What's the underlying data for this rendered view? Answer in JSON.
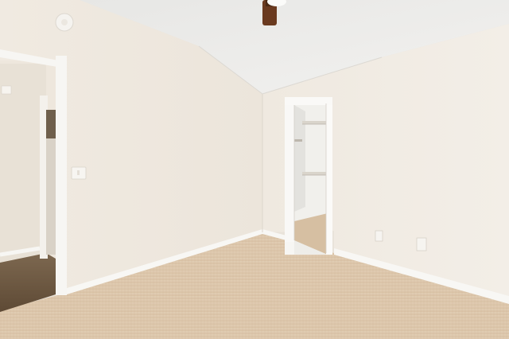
{
  "scene": {
    "kind": "photo",
    "subject": "empty-bedroom",
    "colors": {
      "ceiling": "#ecebe8",
      "left_wall": "#efe9e0",
      "right_wall": "#f1ece4",
      "carpet": "#d9c3a8",
      "trim": "#f7f6f3",
      "hall_floor": "#6f5a43",
      "fan_blade": "#6a3a1f"
    }
  }
}
